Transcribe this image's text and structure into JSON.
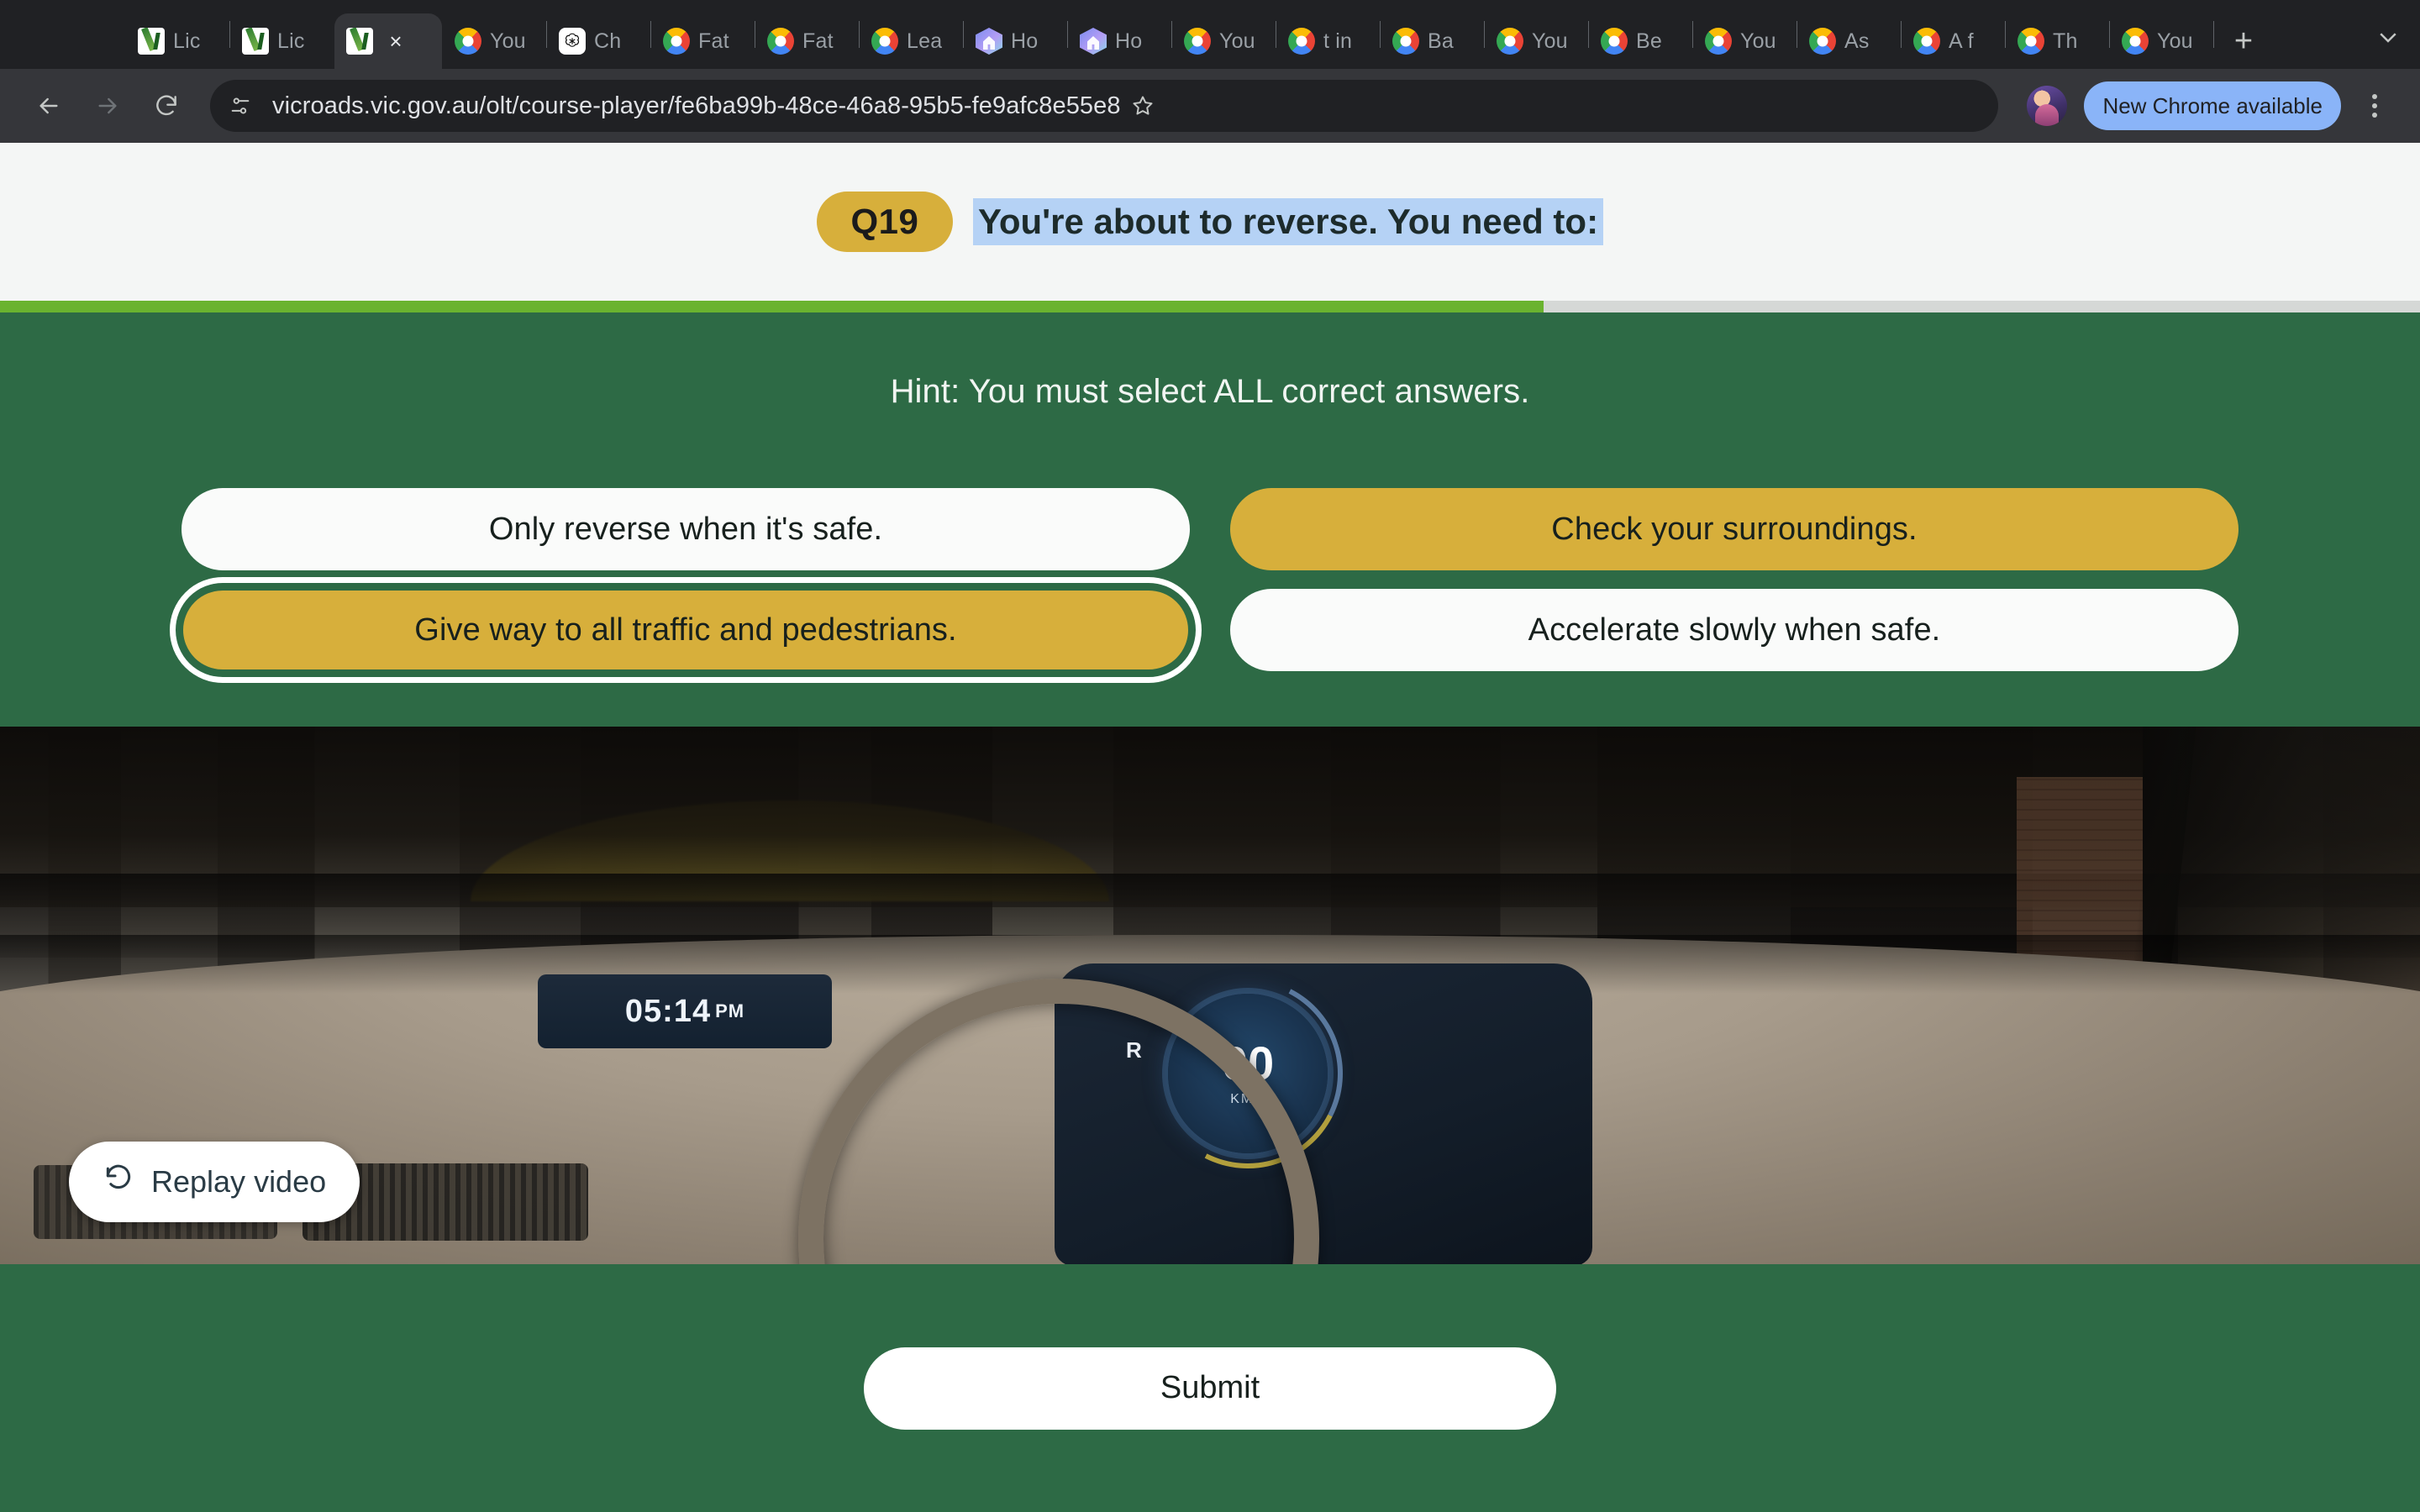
{
  "browser": {
    "tabs": [
      {
        "title": "Lic",
        "icon": "vicroads-favicon",
        "active": false
      },
      {
        "title": "Lic",
        "icon": "vicroads-favicon",
        "active": false
      },
      {
        "title": "",
        "icon": "vicroads-favicon",
        "active": true
      },
      {
        "title": "You",
        "icon": "google-favicon",
        "active": false
      },
      {
        "title": "Ch",
        "icon": "openai-favicon",
        "active": false
      },
      {
        "title": "Fat",
        "icon": "google-favicon",
        "active": false
      },
      {
        "title": "Fat",
        "icon": "google-favicon",
        "active": false
      },
      {
        "title": "Lea",
        "icon": "google-favicon",
        "active": false
      },
      {
        "title": "Ho",
        "icon": "house-favicon",
        "active": false
      },
      {
        "title": "Ho",
        "icon": "house-favicon",
        "active": false
      },
      {
        "title": "You",
        "icon": "google-favicon",
        "active": false
      },
      {
        "title": "t in",
        "icon": "google-favicon",
        "active": false
      },
      {
        "title": "Ba",
        "icon": "google-favicon",
        "active": false
      },
      {
        "title": "You",
        "icon": "google-favicon",
        "active": false
      },
      {
        "title": "Be",
        "icon": "google-favicon",
        "active": false
      },
      {
        "title": "You",
        "icon": "google-favicon",
        "active": false
      },
      {
        "title": "As",
        "icon": "google-favicon",
        "active": false
      },
      {
        "title": "A f",
        "icon": "google-favicon",
        "active": false
      },
      {
        "title": "Th",
        "icon": "google-favicon",
        "active": false
      },
      {
        "title": "You",
        "icon": "google-favicon",
        "active": false
      }
    ],
    "active_tab_close_label": "×",
    "new_tab_label": "+",
    "tab_list_chevron": "chevron-down-icon",
    "back_label": "←",
    "forward_label": "→",
    "reload_label": "↻",
    "url": "vicroads.vic.gov.au/olt/course-player/fe6ba99b-48ce-46a8-95b5-fe9afc8e55e8",
    "bookmark_label": "☆",
    "update_button_label": "New Chrome available"
  },
  "question": {
    "badge": "Q19",
    "text": "You're about to reverse. You need to:",
    "progress_percent": 63.8,
    "hint": "Hint: You must select ALL correct answers."
  },
  "options": [
    {
      "label": "Only reverse when it's safe.",
      "selected": false,
      "focused": false
    },
    {
      "label": "Check your surroundings.",
      "selected": true,
      "focused": false
    },
    {
      "label": "Give way to all traffic and pedestrians.",
      "selected": true,
      "focused": true
    },
    {
      "label": "Accelerate slowly when safe.",
      "selected": false,
      "focused": false
    }
  ],
  "video": {
    "replay_label": "Replay video",
    "replay_icon": "rotate-left-icon",
    "dash_clock": "05:14",
    "dash_clock_ampm": "PM",
    "speed": "00",
    "speed_unit": "KMH",
    "gear": "R"
  },
  "footer": {
    "submit_label": "Submit"
  },
  "colors": {
    "brand_green": "#2d6a45",
    "accent_gold": "#d7af3b",
    "progress_green": "#6ab32f",
    "selection_blue": "#b5d2f5",
    "chrome_dark": "#202124",
    "toolbar_dark": "#35363a",
    "update_blue": "#8ab4f8"
  }
}
